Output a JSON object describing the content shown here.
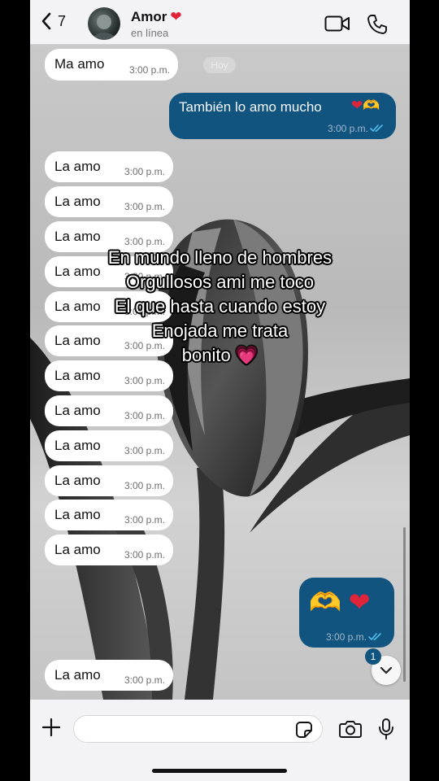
{
  "header": {
    "back_count": "7",
    "contact_name": "Amor",
    "contact_status": "en línea"
  },
  "wallpaper": {
    "date_label": "Hoy"
  },
  "messages": [
    {
      "dir": "in",
      "text": "Ma amo",
      "time": "3:00 p.m."
    },
    {
      "dir": "out",
      "text": "También lo amo mucho",
      "emoji": "❤️🫶",
      "time": "3:00 p.m."
    },
    {
      "dir": "in",
      "text": "La amo",
      "time": "3:00 p.m."
    },
    {
      "dir": "in",
      "text": "La amo",
      "time": "3:00 p.m."
    },
    {
      "dir": "in",
      "text": "La amo",
      "time": "3:00 p.m."
    },
    {
      "dir": "in",
      "text": "La amo",
      "time": "3:00 p.m."
    },
    {
      "dir": "in",
      "text": "La amo",
      "time": "3:00 p.m."
    },
    {
      "dir": "in",
      "text": "La amo",
      "time": "3:00 p.m."
    },
    {
      "dir": "in",
      "text": "La amo",
      "time": "3:00 p.m."
    },
    {
      "dir": "in",
      "text": "La amo",
      "time": "3:00 p.m."
    },
    {
      "dir": "in",
      "text": "La amo",
      "time": "3:00 p.m."
    },
    {
      "dir": "in",
      "text": "La amo",
      "time": "3:00 p.m."
    },
    {
      "dir": "in",
      "text": "La amo",
      "time": "3:00 p.m."
    },
    {
      "dir": "in",
      "text": "La amo",
      "time": "3:00 p.m."
    },
    {
      "dir": "out",
      "text": "🫶 ❤️",
      "time": "3:00 p.m."
    },
    {
      "dir": "in",
      "text": "La amo",
      "time": "3:00 p.m."
    }
  ],
  "overlay_caption": {
    "line1": "En mundo lleno de hombres",
    "line2": "Orgullosos ami me toco",
    "line3": "El que hasta cuando estoy",
    "line4": "Enojada me trata",
    "line5": "bonito",
    "line5_emoji": "💗"
  },
  "scroll_down": {
    "unread_count": "1"
  },
  "colors": {
    "outgoing_bubble": "#115480",
    "incoming_bubble": "#ffffff",
    "header_bg": "#f3f3f5",
    "read_ticks": "#53bdeb",
    "heart": "#e0243a"
  },
  "icons": [
    "chevron-left-icon",
    "video-call-icon",
    "phone-icon",
    "plus-icon",
    "sticker-icon",
    "camera-icon",
    "microphone-icon",
    "chevron-down-icon",
    "double-check-icon"
  ]
}
